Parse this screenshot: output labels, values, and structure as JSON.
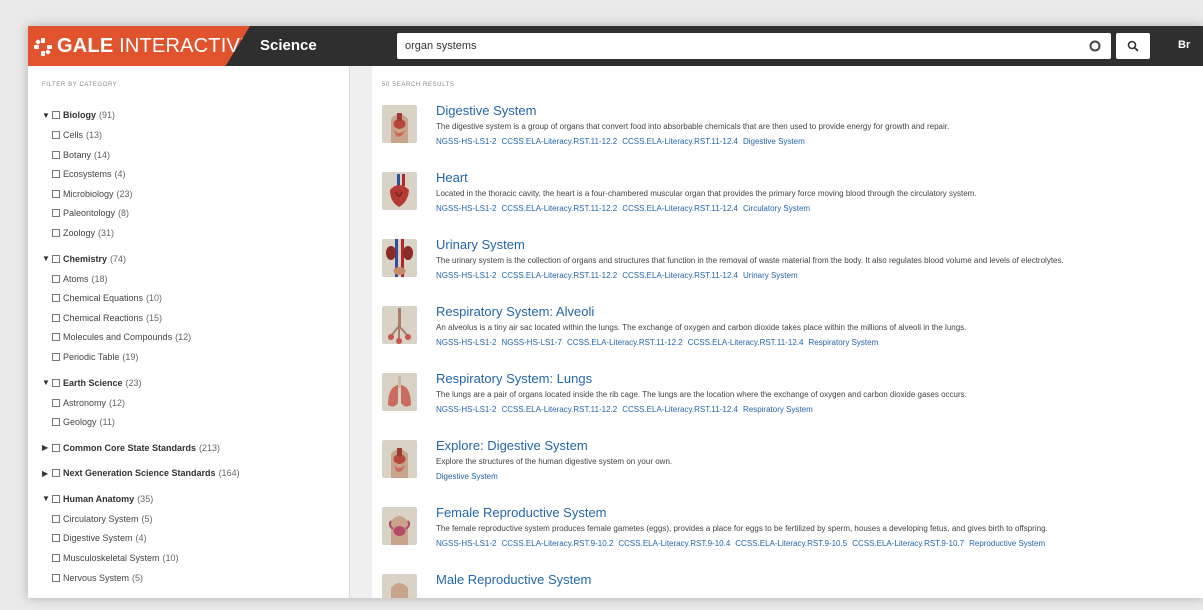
{
  "header": {
    "brand_bold": "GALE",
    "brand_rest": " INTERACTIVE",
    "product": "Science",
    "search_value": "organ systems",
    "browse_label": "Br",
    "brand_color": "#e0532d",
    "bar_color": "#2f2f2f",
    "icons": {
      "clear": "circle-x-icon",
      "search": "search-icon"
    }
  },
  "sidebar": {
    "heading": "FILTER BY CATEGORY",
    "groups": [
      {
        "name": "Biology",
        "count": "(91)",
        "expanded": true,
        "items": [
          {
            "name": "Cells",
            "count": "(13)"
          },
          {
            "name": "Botany",
            "count": "(14)"
          },
          {
            "name": "Ecosystems",
            "count": "(4)"
          },
          {
            "name": "Microbiology",
            "count": "(23)"
          },
          {
            "name": "Paleontology",
            "count": "(8)"
          },
          {
            "name": "Zoology",
            "count": "(31)"
          }
        ]
      },
      {
        "name": "Chemistry",
        "count": "(74)",
        "expanded": true,
        "items": [
          {
            "name": "Atoms",
            "count": "(18)"
          },
          {
            "name": "Chemical Equations",
            "count": "(10)"
          },
          {
            "name": "Chemical Reactions",
            "count": "(15)"
          },
          {
            "name": "Molecules and Compounds",
            "count": "(12)"
          },
          {
            "name": "Periodic Table",
            "count": "(19)"
          }
        ]
      },
      {
        "name": "Earth Science",
        "count": "(23)",
        "expanded": true,
        "items": [
          {
            "name": "Astronomy",
            "count": "(12)"
          },
          {
            "name": "Geology",
            "count": "(11)"
          }
        ]
      },
      {
        "name": "Common Core State Standards",
        "count": "(213)",
        "expanded": false,
        "items": []
      },
      {
        "name": "Next Generation Science Standards",
        "count": "(164)",
        "expanded": false,
        "items": []
      },
      {
        "name": "Human Anatomy",
        "count": "(35)",
        "expanded": true,
        "items": [
          {
            "name": "Circulatory System",
            "count": "(5)"
          },
          {
            "name": "Digestive System",
            "count": "(4)"
          },
          {
            "name": "Musculoskeletal System",
            "count": "(10)"
          },
          {
            "name": "Nervous System",
            "count": "(5)"
          }
        ]
      }
    ]
  },
  "results": {
    "count_label": "50 SEARCH RESULTS",
    "link_color": "#2366ab",
    "items": [
      {
        "title": "Digestive System",
        "desc": "The digestive system is a group of organs that convert food into absorbable chemicals that are then used to provide energy for growth and repair.",
        "tags": [
          "NGSS-HS-LS1-2",
          "CCSS.ELA-Literacy.RST.11-12.2",
          "CCSS.ELA-Literacy.RST.11-12.4",
          "Digestive System"
        ],
        "thumb": "digestive"
      },
      {
        "title": "Heart",
        "desc": "Located in the thoracic cavity, the heart is a four-chambered muscular organ that provides the primary force moving blood through the circulatory system.",
        "tags": [
          "NGSS-HS-LS1-2",
          "CCSS.ELA-Literacy.RST.11-12.2",
          "CCSS.ELA-Literacy.RST.11-12.4",
          "Circulatory System"
        ],
        "thumb": "heart"
      },
      {
        "title": "Urinary System",
        "desc": "The urinary system is the collection of organs and structures that function in the removal of waste material from the body. It also regulates blood volume and levels of electrolytes.",
        "tags": [
          "NGSS-HS-LS1-2",
          "CCSS.ELA-Literacy.RST.11-12.2",
          "CCSS.ELA-Literacy.RST.11-12.4",
          "Urinary System"
        ],
        "thumb": "urinary"
      },
      {
        "title": "Respiratory System: Alveoli",
        "desc": "An alveolus is a tiny air sac located within the lungs. The exchange of oxygen and carbon dioxide takes place within the millions of alveoli in the lungs.",
        "tags": [
          "NGSS-HS-LS1-2",
          "NGSS-HS-LS1-7",
          "CCSS.ELA-Literacy.RST.11-12.2",
          "CCSS.ELA-Literacy.RST.11-12.4",
          "Respiratory System"
        ],
        "thumb": "alveoli"
      },
      {
        "title": "Respiratory System: Lungs",
        "desc": "The lungs are a pair of organs located inside the rib cage. The lungs are the location where the exchange of oxygen and carbon dioxide gases occurs.",
        "tags": [
          "NGSS-HS-LS1-2",
          "CCSS.ELA-Literacy.RST.11-12.2",
          "CCSS.ELA-Literacy.RST.11-12.4",
          "Respiratory System"
        ],
        "thumb": "lungs"
      },
      {
        "title": "Explore: Digestive System",
        "desc": "Explore the structures of the human digestive system on your own.",
        "tags": [
          "Digestive System"
        ],
        "thumb": "digestive"
      },
      {
        "title": "Female Reproductive System",
        "desc": "The female reproductive system produces female gametes (eggs), provides a place for eggs to be fertilized by sperm, houses a developing fetus, and gives birth to offspring.",
        "tags": [
          "NGSS-HS-LS1-2",
          "CCSS.ELA-Literacy.RST.9-10.2",
          "CCSS.ELA-Literacy.RST.9-10.4",
          "CCSS.ELA-Literacy.RST.9-10.5",
          "CCSS.ELA-Literacy.RST.9-10.7",
          "Reproductive System"
        ],
        "thumb": "female"
      },
      {
        "title": "Male Reproductive System",
        "desc": "",
        "tags": [],
        "thumb": "male"
      }
    ]
  }
}
